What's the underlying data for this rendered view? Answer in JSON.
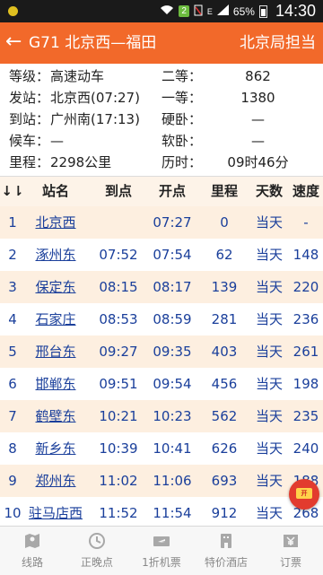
{
  "status_bar": {
    "battery": "65%",
    "time": "14:30",
    "sim_badge": "2",
    "net": "E"
  },
  "header": {
    "back_symbol": "←",
    "title": "G71 北京西—福田",
    "right": "北京局担当"
  },
  "info": {
    "left": [
      {
        "k": "等级：",
        "v": "高速动车"
      },
      {
        "k": "发站：",
        "v": "北京西(07:27)"
      },
      {
        "k": "到站：",
        "v": "广州南(17:13)"
      },
      {
        "k": "候车：",
        "v": "—"
      },
      {
        "k": "里程：",
        "v": "2298公里"
      }
    ],
    "right": [
      {
        "k": "二等：",
        "v": "862"
      },
      {
        "k": "一等：",
        "v": "1380"
      },
      {
        "k": "硬卧：",
        "v": "—"
      },
      {
        "k": "软卧：",
        "v": "—"
      },
      {
        "k": "历时：",
        "v": "09时46分"
      }
    ]
  },
  "table": {
    "headers": [
      "↓⇂",
      "站名",
      "到点",
      "开点",
      "里程",
      "天数",
      "速度"
    ],
    "rows": [
      [
        "1",
        "北京西",
        "",
        "07:27",
        "0",
        "当天",
        "-"
      ],
      [
        "2",
        "涿州东",
        "07:52",
        "07:54",
        "62",
        "当天",
        "148"
      ],
      [
        "3",
        "保定东",
        "08:15",
        "08:17",
        "139",
        "当天",
        "220"
      ],
      [
        "4",
        "石家庄",
        "08:53",
        "08:59",
        "281",
        "当天",
        "236"
      ],
      [
        "5",
        "邢台东",
        "09:27",
        "09:35",
        "403",
        "当天",
        "261"
      ],
      [
        "6",
        "邯郸东",
        "09:51",
        "09:54",
        "456",
        "当天",
        "198"
      ],
      [
        "7",
        "鹤壁东",
        "10:21",
        "10:23",
        "562",
        "当天",
        "235"
      ],
      [
        "8",
        "新乡东",
        "10:39",
        "10:41",
        "626",
        "当天",
        "240"
      ],
      [
        "9",
        "郑州东",
        "11:02",
        "11:06",
        "693",
        "当天",
        "188"
      ],
      [
        "10",
        "驻马店西",
        "11:52",
        "11:54",
        "912",
        "当天",
        "268"
      ]
    ]
  },
  "tabs": [
    {
      "label": "线路",
      "icon": "map-icon"
    },
    {
      "label": "正晚点",
      "icon": "clock-icon"
    },
    {
      "label": "1折机票",
      "icon": "plane-ticket-icon"
    },
    {
      "label": "特价酒店",
      "icon": "hotel-icon"
    },
    {
      "label": "订票",
      "icon": "ticket-yen-icon"
    }
  ],
  "float_button": {
    "icon": "red-packet-icon",
    "text": "开"
  },
  "colors": {
    "accent": "#f2692a",
    "row_odd": "#fdefe0",
    "link": "#1a3f9b"
  }
}
